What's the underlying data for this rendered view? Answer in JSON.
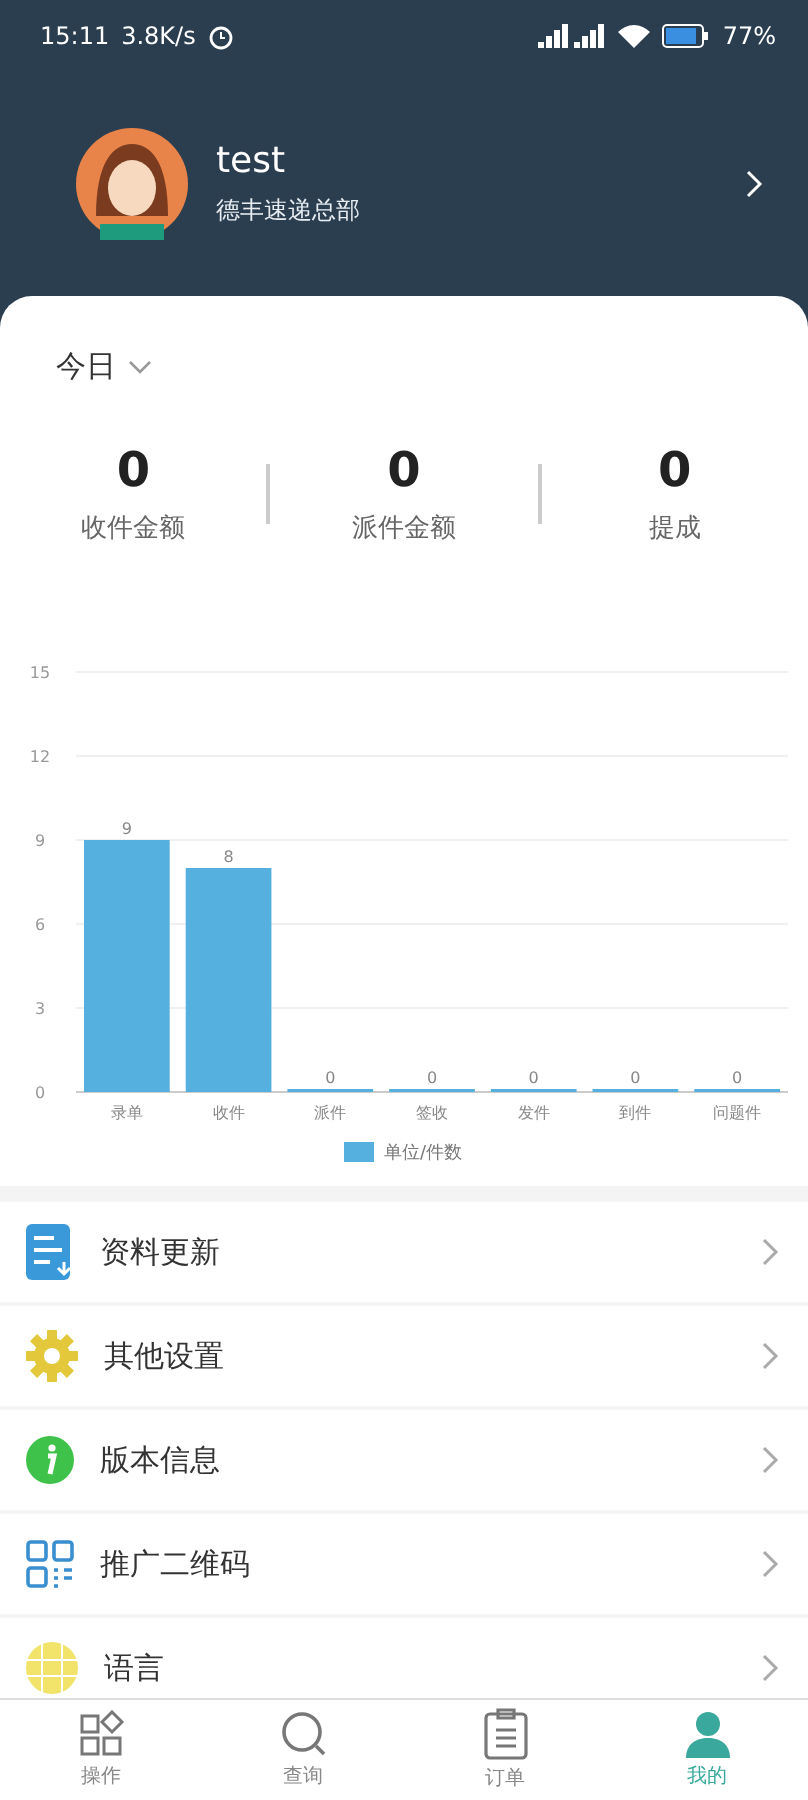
{
  "status_bar": {
    "time": "15:11",
    "speed": "3.8K/s",
    "battery": "77%"
  },
  "profile": {
    "name": "test",
    "company": "德丰速递总部"
  },
  "period": {
    "label": "今日"
  },
  "stats": [
    {
      "value": "0",
      "label": "收件金额"
    },
    {
      "value": "0",
      "label": "派件金额"
    },
    {
      "value": "0",
      "label": "提成"
    }
  ],
  "chart_data": {
    "type": "bar",
    "categories": [
      "录单",
      "收件",
      "派件",
      "签收",
      "发件",
      "到件",
      "问题件"
    ],
    "ylim": [
      0,
      15
    ],
    "yticks": [
      0,
      3,
      6,
      9,
      12,
      15
    ],
    "data_labels": true,
    "grid": true,
    "series": [
      {
        "name": "单位/件数",
        "color": "#55b0e0",
        "values": [
          9,
          8,
          0,
          0,
          0,
          0,
          0
        ]
      }
    ]
  },
  "menu": [
    {
      "kind": "update",
      "label": "资料更新"
    },
    {
      "kind": "settings",
      "label": "其他设置"
    },
    {
      "kind": "info",
      "label": "版本信息"
    },
    {
      "kind": "qr",
      "label": "推广二维码"
    },
    {
      "kind": "language",
      "label": "语言"
    }
  ],
  "nav": [
    {
      "kind": "operate",
      "label": "操作",
      "selected": false
    },
    {
      "kind": "query",
      "label": "查询",
      "selected": false
    },
    {
      "kind": "orders",
      "label": "订单",
      "selected": false
    },
    {
      "kind": "mine",
      "label": "我的",
      "selected": true
    }
  ]
}
